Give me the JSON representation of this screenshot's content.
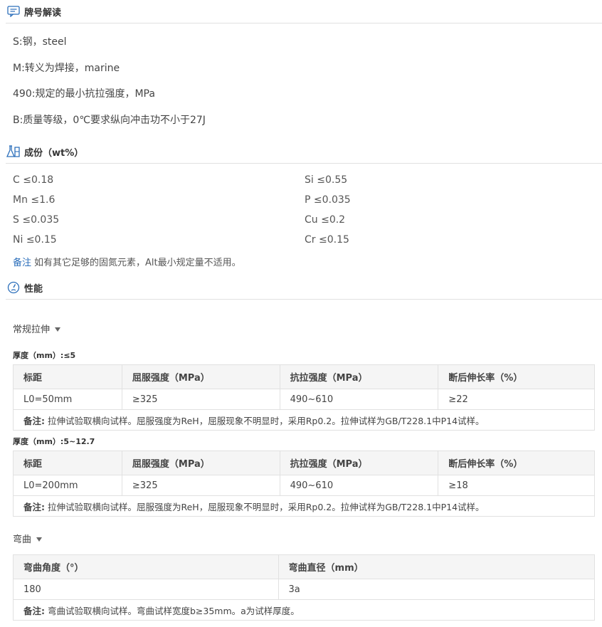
{
  "sections": {
    "designation": {
      "title": "牌号解读",
      "icon": "chat-box-icon"
    },
    "composition": {
      "title": "成份（wt%）",
      "icon": "flask-icon"
    },
    "properties": {
      "title": "性能",
      "icon": "gauge-icon"
    }
  },
  "designation_lines": [
    "S:钢，steel",
    "M:转义为焊接，marine",
    "490:规定的最小抗拉强度，MPa",
    "B:质量等级，0℃要求纵向冲击功不小于27J"
  ],
  "composition": {
    "items": [
      "C ≤0.18",
      "Si ≤0.55",
      "Mn ≤1.6",
      "P ≤0.035",
      "S ≤0.035",
      "Cu ≤0.2",
      "Ni ≤0.15",
      "Cr ≤0.15"
    ],
    "note_label": "备注",
    "note_text": "如有其它足够的固氮元素，Alt最小规定量不适用。"
  },
  "tensile": {
    "label": "常规拉伸",
    "groups": [
      {
        "thickness": "厚度（mm）:≤5",
        "headers": [
          "标距",
          "屈服强度（MPa）",
          "抗拉强度（MPa）",
          "断后伸长率（%）"
        ],
        "row": [
          "L0=50mm",
          "≥325",
          "490~610",
          "≥22"
        ],
        "remark_label": "备注:",
        "remark": "拉伸试验取横向试样。屈服强度为ReH，屈服现象不明显时，采用Rp0.2。拉伸试样为GB/T228.1中P14试样。"
      },
      {
        "thickness": "厚度（mm）:5~12.7",
        "headers": [
          "标距",
          "屈服强度（MPa）",
          "抗拉强度（MPa）",
          "断后伸长率（%）"
        ],
        "row": [
          "L0=200mm",
          "≥325",
          "490~610",
          "≥18"
        ],
        "remark_label": "备注:",
        "remark": "拉伸试验取横向试样。屈服强度为ReH，屈服现象不明显时，采用Rp0.2。拉伸试样为GB/T228.1中P14试样。"
      }
    ]
  },
  "bend": {
    "label": "弯曲",
    "headers": [
      "弯曲角度（°）",
      "弯曲直径（mm）"
    ],
    "row": [
      "180",
      "3a"
    ],
    "remark_label": "备注:",
    "remark": "弯曲试验取横向试样。弯曲试样宽度b≥35mm。a为试样厚度。"
  },
  "colors": {
    "accent": "#2c6fbb",
    "border": "#e1e1e1",
    "header_bg": "#f5f5f5"
  }
}
